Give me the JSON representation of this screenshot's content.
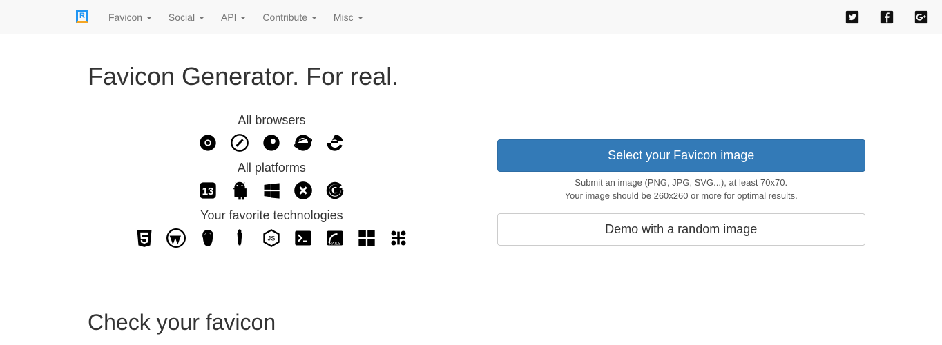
{
  "nav": {
    "items": [
      {
        "label": "Favicon"
      },
      {
        "label": "Social"
      },
      {
        "label": "API"
      },
      {
        "label": "Contribute"
      },
      {
        "label": "Misc"
      }
    ]
  },
  "hero": {
    "title": "Favicon Generator. For real."
  },
  "sections": {
    "browsers_label": "All browsers",
    "platforms_label": "All platforms",
    "tech_label": "Your favorite technologies"
  },
  "icons": {
    "browsers": [
      "chrome",
      "safari",
      "firefox",
      "ie",
      "edge"
    ],
    "platforms": [
      "ios",
      "android",
      "windows",
      "macos",
      "google"
    ],
    "tech": [
      "html5",
      "wordpress",
      "grunt",
      "gulp",
      "nodejs",
      "terminal",
      "rails",
      "microsoft",
      "joomla"
    ]
  },
  "actions": {
    "select_button": "Select your Favicon image",
    "help1": "Submit an image (PNG, JPG, SVG...), at least 70x70.",
    "help2": "Your image should be 260x260 or more for optimal results.",
    "demo_button": "Demo with a random image"
  },
  "check": {
    "title": "Check your favicon"
  },
  "colors": {
    "primary": "#337ab7"
  }
}
